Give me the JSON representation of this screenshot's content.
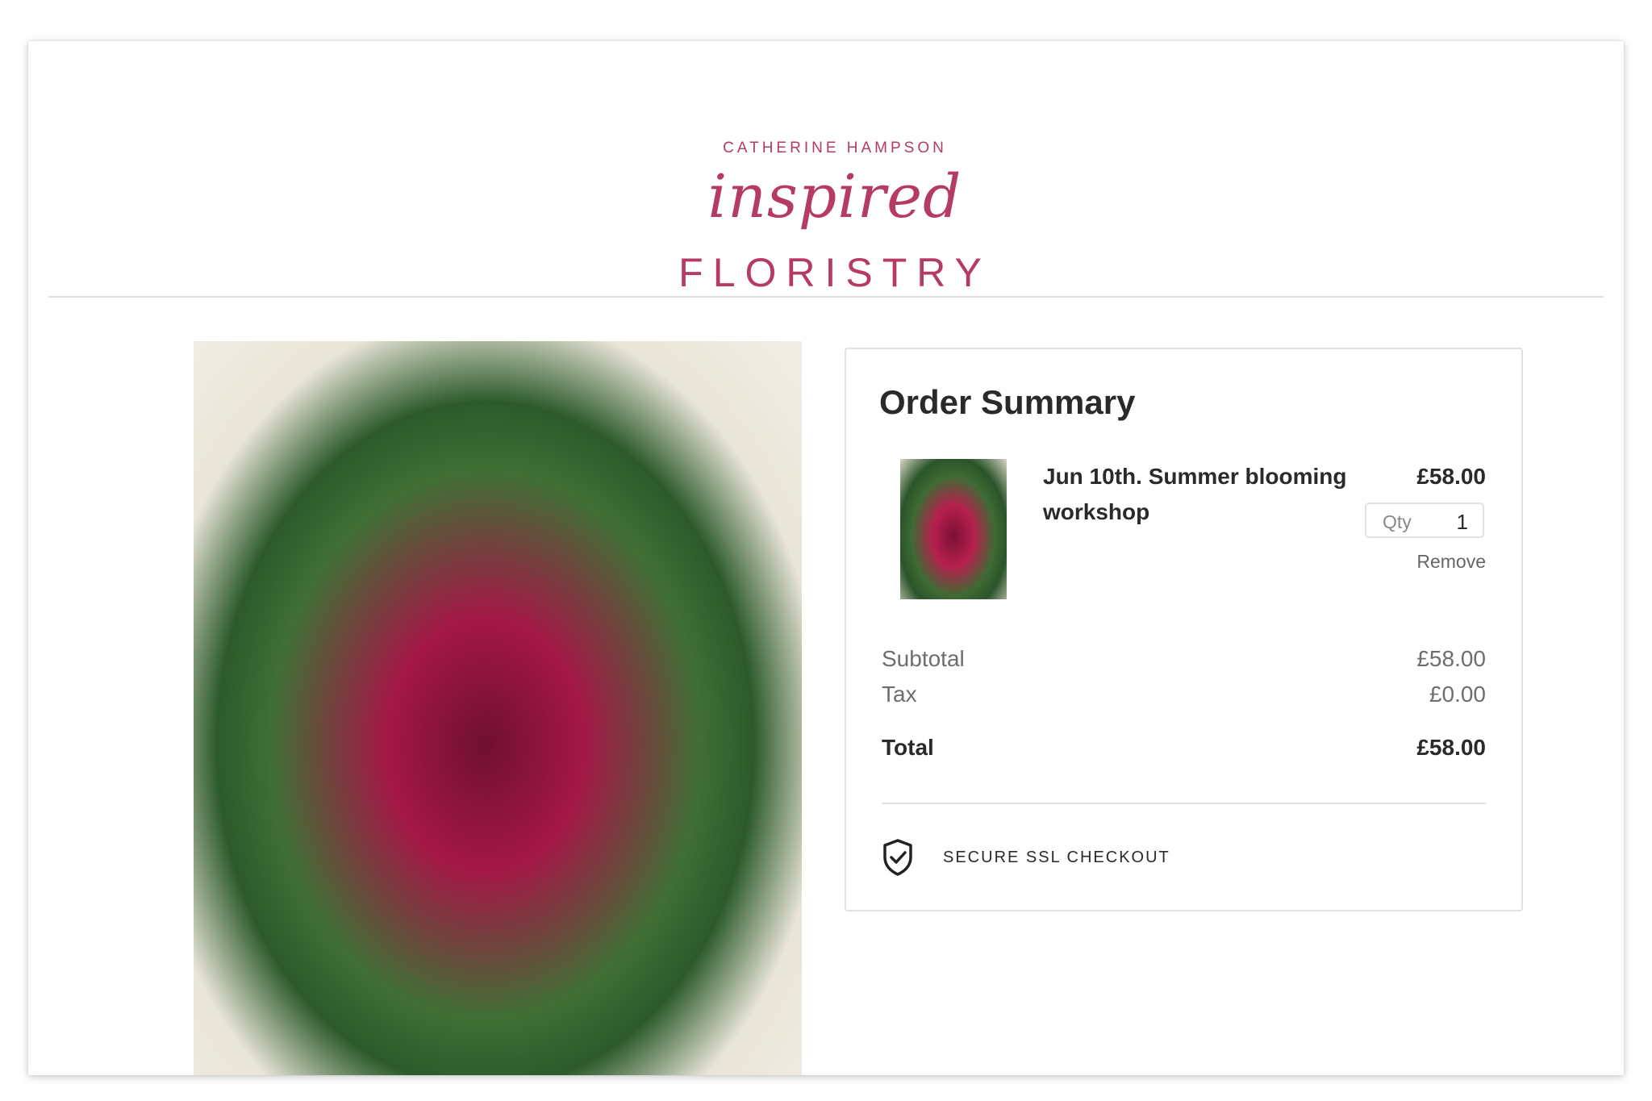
{
  "brand": {
    "name_top": "CATHERINE HAMPSON",
    "name_script": "inspired",
    "name_bottom": "FLORISTRY",
    "color": "#b53a66"
  },
  "hero": {
    "icon": "flower-bouquet-image"
  },
  "order_summary": {
    "title": "Order Summary",
    "item": {
      "name": "Jun 10th. Summer blooming workshop",
      "price": "£58.00",
      "qty_label": "Qty",
      "qty_value": "1",
      "remove_label": "Remove",
      "thumbnail_icon": "flower-bouquet-thumbnail"
    },
    "subtotal_label": "Subtotal",
    "subtotal_value": "£58.00",
    "tax_label": "Tax",
    "tax_value": "£0.00",
    "total_label": "Total",
    "total_value": "£58.00",
    "secure_label": "SECURE SSL CHECKOUT",
    "secure_icon": "shield-check-icon"
  }
}
